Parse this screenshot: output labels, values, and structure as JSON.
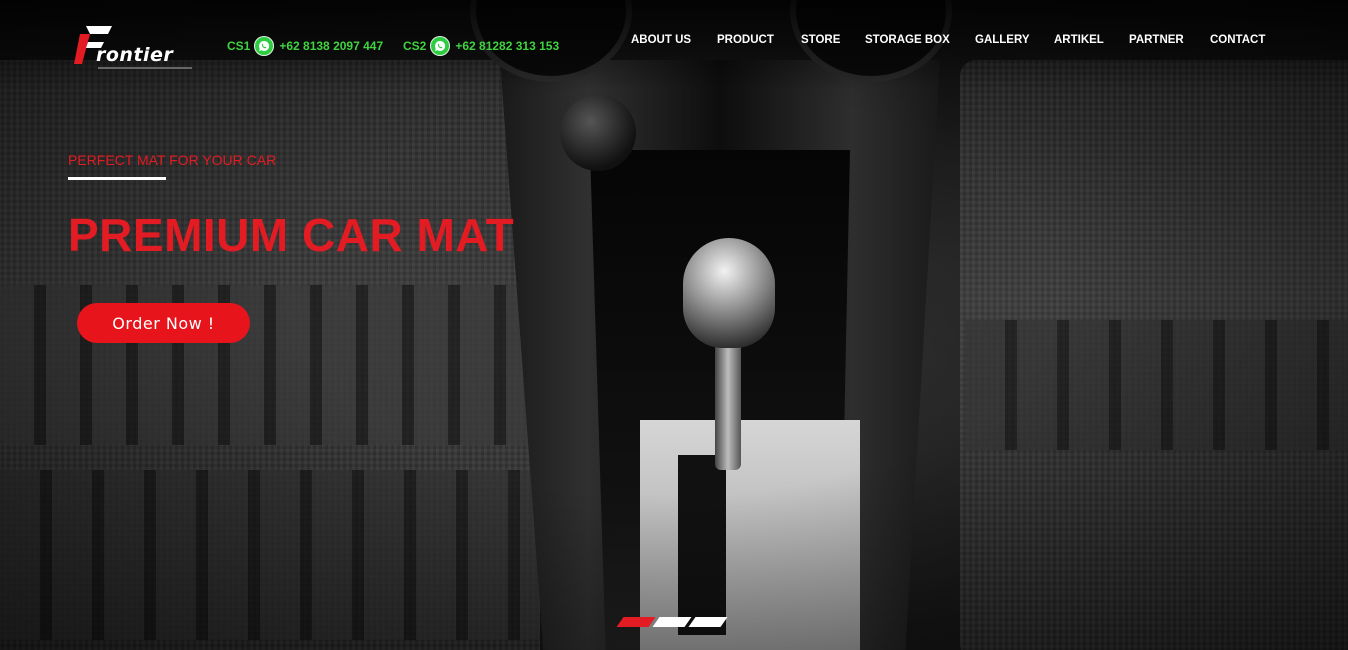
{
  "brand": {
    "name": "rontier",
    "logo_color": "#e31b23"
  },
  "contacts": [
    {
      "label": "CS1",
      "icon": "whatsapp-icon",
      "phone": "+62 8138 2097 447"
    },
    {
      "label": "CS2",
      "icon": "whatsapp-icon",
      "phone": "+62 81282 313 153"
    }
  ],
  "nav": {
    "items": [
      {
        "label": "ABOUT US"
      },
      {
        "label": "PRODUCT"
      },
      {
        "label": "STORE"
      },
      {
        "label": "STORAGE BOX"
      },
      {
        "label": "GALLERY"
      },
      {
        "label": "ARTIKEL"
      },
      {
        "label": "PARTNER"
      },
      {
        "label": "CONTACT"
      }
    ]
  },
  "hero": {
    "tagline": "PERFECT MAT FOR YOUR CAR",
    "headline": "PREMIUM CAR MAT",
    "cta_label": "Order Now !",
    "slides_total": 3,
    "active_slide": 1
  },
  "colors": {
    "accent": "#e31b23",
    "whatsapp": "#3fd43f",
    "nav_text": "#ffffff"
  }
}
